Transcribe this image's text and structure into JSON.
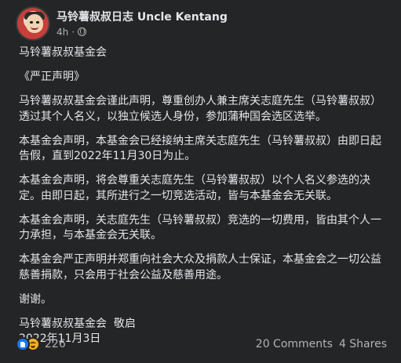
{
  "post": {
    "author": "马铃薯叔叔日志 Uncle Kentang",
    "timestamp": "4h",
    "paragraphs": [
      "马铃薯叔叔基金会",
      "《严正声明》",
      "马铃薯叔叔基金会谨此声明，尊重创办人兼主席关志庭先生（马铃薯叔叔）透过其个人名义，以独立候选人身份，参加蒲种国会选区选举。",
      "本基金会声明，本基金会已经接纳主席关志庭先生（马铃薯叔叔）由即日起告假，直到2022年11月30日为止。",
      "本基金会声明，将会尊重关志庭先生（马铃薯叔叔）以个人名义参选的决定。由即日起，其所进行之一切竞选活动，皆与本基金会无关联。",
      "本基金会声明，关志庭先生（马铃薯叔叔）竞选的一切费用，皆由其个人一力承担，与本基金会无关联。",
      "本基金会严正声明并郑重向社会大众及捐款人士保证，本基金会之一切公益慈善捐款，只会用于社会公益及慈善用途。",
      "谢谢。"
    ],
    "signature": "马铃薯叔叔基金会  敬启",
    "date": "2022年11月3日"
  },
  "footer": {
    "reaction_count": "226",
    "comments": "20 Comments",
    "shares": "4 Shares"
  },
  "icons": {
    "privacy": "globe-icon",
    "reaction1": "like-icon",
    "reaction2": "haha-icon"
  },
  "colors": {
    "background": "#242526",
    "text": "#e4e6eb",
    "secondary_text": "#b0b3b8",
    "like_blue": "#1877f2",
    "haha_yellow": "#f7b125"
  }
}
